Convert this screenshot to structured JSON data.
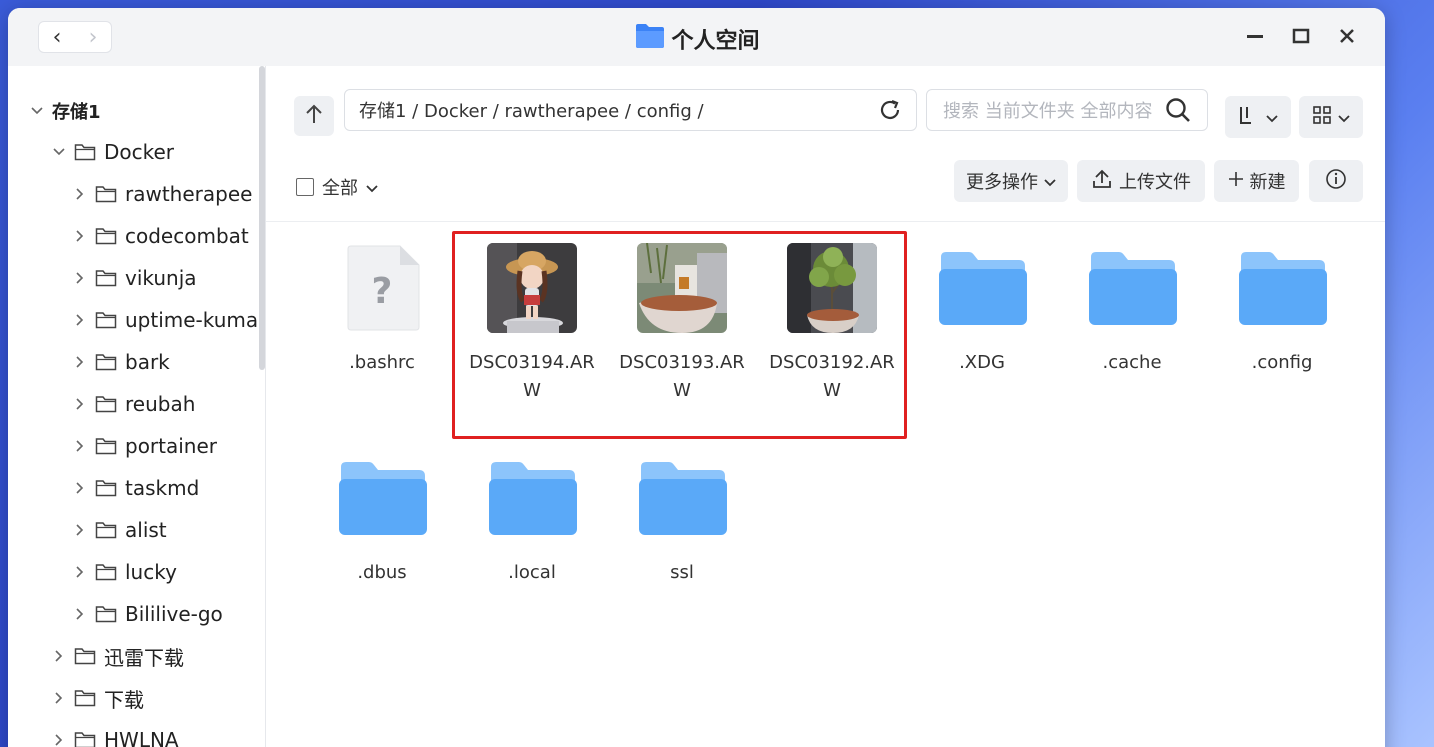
{
  "window": {
    "title": "个人空间",
    "back_symbol": "‹",
    "forward_symbol": "›"
  },
  "sidebar": {
    "root": "存储1",
    "docker": "Docker",
    "docker_children": [
      "rawtherapee",
      "codecombat",
      "vikunja",
      "uptime-kuma",
      "bark",
      "reubah",
      "portainer",
      "taskmd",
      "alist",
      "lucky",
      "Bililive-go"
    ],
    "siblings": [
      "迅雷下载",
      "下载",
      "HWLNA"
    ]
  },
  "toolbar": {
    "path": "存储1 / Docker / rawtherapee / config /",
    "search_placeholder": "搜索 当前文件夹 全部内容",
    "select_all": "全部",
    "more_actions": "更多操作",
    "upload": "上传文件",
    "new": "新建"
  },
  "files": [
    {
      "name": ".bashrc",
      "kind": "unknown"
    },
    {
      "name": "DSC03194.ARW",
      "kind": "photo-figure"
    },
    {
      "name": "DSC03193.ARW",
      "kind": "photo-pot"
    },
    {
      "name": "DSC03192.ARW",
      "kind": "photo-tree"
    },
    {
      "name": ".XDG",
      "kind": "folder"
    },
    {
      "name": ".cache",
      "kind": "folder"
    },
    {
      "name": ".config",
      "kind": "folder"
    },
    {
      "name": ".dbus",
      "kind": "folder"
    },
    {
      "name": ".local",
      "kind": "folder"
    },
    {
      "name": "ssl",
      "kind": "folder"
    }
  ],
  "colors": {
    "accent": "#3b82f6",
    "folder": "#5aa9f8",
    "highlight": "#e02020"
  }
}
